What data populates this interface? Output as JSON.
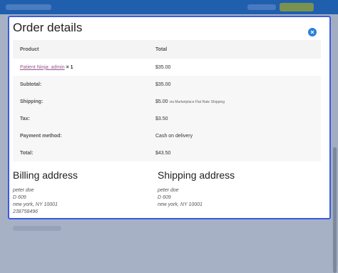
{
  "modal": {
    "title": "Order details",
    "table": {
      "headers": [
        "Product",
        "Total"
      ],
      "product": {
        "name": "Patient Ninja: admin",
        "qty": "× 1",
        "total": "$35.00"
      },
      "rows": [
        {
          "label": "Subtotal:",
          "value": "$35.00",
          "note": ""
        },
        {
          "label": "Shipping:",
          "value": "$5.00",
          "note": "via Marketplace Flat Rate Shipping"
        },
        {
          "label": "Tax:",
          "value": "$3.50",
          "note": ""
        },
        {
          "label": "Payment method:",
          "value": "Cash on delivery",
          "note": ""
        },
        {
          "label": "Total:",
          "value": "$43.50",
          "note": ""
        }
      ]
    },
    "billing": {
      "title": "Billing address",
      "lines": [
        "peter doe",
        "D 609",
        "new york, NY 10001",
        "238758496"
      ]
    },
    "shipping": {
      "title": "Shipping address",
      "lines": [
        "peter doe",
        "D 609",
        "new york, NY 10001"
      ]
    }
  },
  "colors": {
    "accent": "#3b5bdb",
    "link": "#96588a",
    "topbar": "#1f5fae",
    "close_button": "#2a80d8"
  },
  "icons": {
    "close": "close-icon"
  }
}
